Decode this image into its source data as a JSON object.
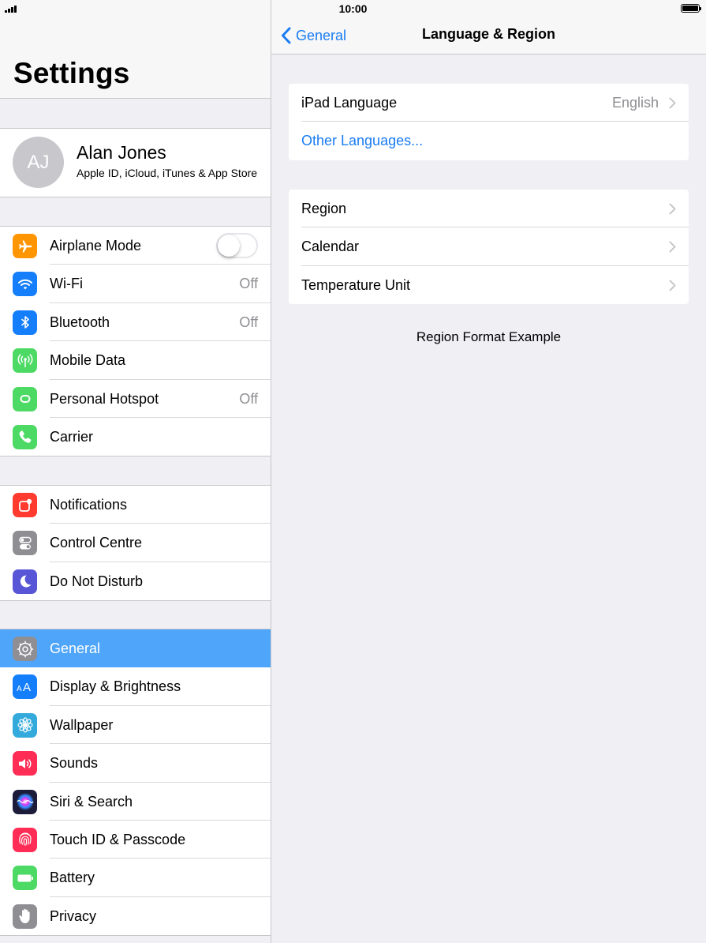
{
  "status": {
    "time": "10:00"
  },
  "settings": {
    "title": "Settings",
    "profile": {
      "initials": "AJ",
      "name": "Alan Jones",
      "subtitle": "Apple ID, iCloud, iTunes & App Store"
    },
    "groups": [
      [
        {
          "label": "Airplane Mode",
          "value": "",
          "icon": "airplane-icon",
          "color": "#ff9500",
          "toggle": true
        },
        {
          "label": "Wi-Fi",
          "value": "Off",
          "icon": "wifi-icon",
          "color": "#147efb"
        },
        {
          "label": "Bluetooth",
          "value": "Off",
          "icon": "bluetooth-icon",
          "color": "#147efb"
        },
        {
          "label": "Mobile Data",
          "value": "",
          "icon": "antenna-icon",
          "color": "#4cd964"
        },
        {
          "label": "Personal Hotspot",
          "value": "Off",
          "icon": "hotspot-icon",
          "color": "#4cd964"
        },
        {
          "label": "Carrier",
          "value": "",
          "icon": "phone-icon",
          "color": "#4cd964"
        }
      ],
      [
        {
          "label": "Notifications",
          "value": "",
          "icon": "notifications-icon",
          "color": "#ff3b30"
        },
        {
          "label": "Control Centre",
          "value": "",
          "icon": "control-centre-icon",
          "color": "#8e8e93"
        },
        {
          "label": "Do Not Disturb",
          "value": "",
          "icon": "moon-icon",
          "color": "#5856d6"
        }
      ],
      [
        {
          "label": "General",
          "value": "",
          "icon": "gear-icon",
          "color": "#8e8e93",
          "selected": true
        },
        {
          "label": "Display & Brightness",
          "value": "",
          "icon": "display-icon",
          "color": "#147efb"
        },
        {
          "label": "Wallpaper",
          "value": "",
          "icon": "wallpaper-icon",
          "color": "#34aadc"
        },
        {
          "label": "Sounds",
          "value": "",
          "icon": "speaker-icon",
          "color": "#ff2d55"
        },
        {
          "label": "Siri & Search",
          "value": "",
          "icon": "siri-icon",
          "color": "#1c1c3a"
        },
        {
          "label": "Touch ID & Passcode",
          "value": "",
          "icon": "fingerprint-icon",
          "color": "#ff2d55"
        },
        {
          "label": "Battery",
          "value": "",
          "icon": "battery-icon",
          "color": "#4cd964"
        },
        {
          "label": "Privacy",
          "value": "",
          "icon": "hand-icon",
          "color": "#8e8e93"
        }
      ]
    ]
  },
  "detail": {
    "back_label": "General",
    "title": "Language & Region",
    "language_card": [
      {
        "label": "iPad Language",
        "value": "English",
        "chevron": true
      },
      {
        "label": "Other Languages...",
        "value": "",
        "chevron": false,
        "link": true
      }
    ],
    "region_card": [
      {
        "label": "Region",
        "value": "",
        "chevron": true
      },
      {
        "label": "Calendar",
        "value": "",
        "chevron": true
      },
      {
        "label": "Temperature Unit",
        "value": "",
        "chevron": true
      }
    ],
    "example_heading": "Region Format Example"
  }
}
